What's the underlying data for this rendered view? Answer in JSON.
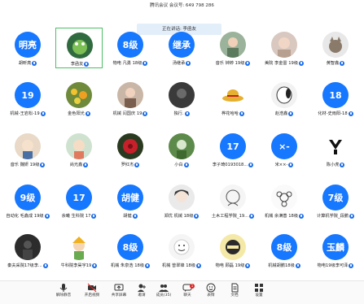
{
  "header": {
    "title": "腾讯会议 会议号: 649 798 286"
  },
  "speaking": {
    "text": "正在讲话: 李函友"
  },
  "participants": [
    {
      "name": "胡昕亮",
      "avatar": "明亮",
      "kind": "text",
      "extra": ""
    },
    {
      "name": "李函友",
      "avatar": "frog-avatar",
      "kind": "pic",
      "extra": ""
    },
    {
      "name": "物电 凡勇 18级",
      "avatar": "8级",
      "kind": "text",
      "extra": ""
    },
    {
      "name": "汤继承",
      "avatar": "继承",
      "kind": "text",
      "extra": ""
    },
    {
      "name": "音乐 钟婷 19级",
      "avatar": "girl-photo-avatar",
      "kind": "pic",
      "extra": ""
    },
    {
      "name": "美院 李金雷 19级",
      "avatar": "portrait-avatar",
      "kind": "pic",
      "extra": ""
    },
    {
      "name": "黄智鑫",
      "avatar": "cat-avatar",
      "kind": "pic",
      "extra": ""
    },
    {
      "name": "机械-王岩松-19",
      "avatar": "19",
      "kind": "text",
      "extra": ""
    },
    {
      "name": "金色阳光",
      "avatar": "flowers-avatar",
      "kind": "pic",
      "extra": ""
    },
    {
      "name": "机械 闫国庆 19",
      "avatar": "person-avatar",
      "kind": "pic",
      "extra": ""
    },
    {
      "name": "独行.",
      "avatar": "dark-avatar",
      "kind": "pic",
      "extra": ""
    },
    {
      "name": "桦花哈哈",
      "avatar": "straw-hat-avatar",
      "kind": "pic",
      "extra": ""
    },
    {
      "name": "赵浩鑫",
      "avatar": "snoopy-avatar",
      "kind": "pic",
      "extra": ""
    },
    {
      "name": "化材-史雨阳-18",
      "avatar": "18",
      "kind": "text",
      "extra": ""
    },
    {
      "name": "音乐 魏妍 19级",
      "avatar": "cartoon-avatar",
      "kind": "pic",
      "extra": ""
    },
    {
      "name": "尚光鑫",
      "avatar": "baby-avatar",
      "kind": "pic",
      "extra": ""
    },
    {
      "name": "罗红杰",
      "avatar": "red-flower-avatar",
      "kind": "pic",
      "extra": ""
    },
    {
      "name": "小白",
      "avatar": "green-avatar",
      "kind": "pic",
      "extra": ""
    },
    {
      "name": "李子琦0193018...",
      "avatar": "17",
      "kind": "text",
      "extra": ""
    },
    {
      "name": "米××-",
      "avatar": "×-",
      "kind": "text",
      "extra": ""
    },
    {
      "name": "陈小虎",
      "avatar": "kobe-logo-avatar",
      "kind": "pic",
      "extra": ""
    },
    {
      "name": "自动化 毛鑫成 19级",
      "avatar": "9级",
      "kind": "text",
      "extra": ""
    },
    {
      "name": "余曦 生科院 17",
      "avatar": "17",
      "kind": "text",
      "extra": ""
    },
    {
      "name": "胡健",
      "avatar": "胡健",
      "kind": "text",
      "extra": ""
    },
    {
      "name": "郑优 机械 18级",
      "avatar": "anime-avatar",
      "kind": "pic",
      "extra": ""
    },
    {
      "name": "土木工程学院_19...",
      "avatar": "sketch-avatar",
      "kind": "pic",
      "extra": ""
    },
    {
      "name": "机械 余满善 18级",
      "avatar": "flower-sketch-avatar",
      "kind": "pic",
      "extra": ""
    },
    {
      "name": "计算机学院_段鹏",
      "avatar": "7级",
      "kind": "text",
      "extra": ""
    },
    {
      "name": "秦夫采院17级李...",
      "avatar": "dark-figure-avatar",
      "kind": "pic",
      "extra": ""
    },
    {
      "name": "牛科院李昊宇19",
      "avatar": "boy-cartoon-avatar",
      "kind": "pic",
      "extra": ""
    },
    {
      "name": "机械 朱泉浩 18级",
      "avatar": "8级",
      "kind": "text",
      "extra": ""
    },
    {
      "name": "机械 曾翠锋 18级",
      "avatar": "white-face-avatar",
      "kind": "pic",
      "extra": ""
    },
    {
      "name": "物电 顾磊 19级",
      "avatar": "ninja-avatar",
      "kind": "pic",
      "extra": ""
    },
    {
      "name": "机械胡鹏18级",
      "avatar": "8级",
      "kind": "text",
      "extra": ""
    },
    {
      "name": "物电19级李可泽",
      "avatar": "玉麟",
      "kind": "text",
      "extra": ""
    }
  ],
  "toolbar": [
    {
      "label": "解除静音",
      "icon": "mic-icon"
    },
    {
      "label": "开启视频",
      "icon": "camera-icon"
    },
    {
      "label": "共享屏幕",
      "icon": "share-screen-icon"
    },
    {
      "label": "邀请",
      "icon": "invite-icon"
    },
    {
      "label": "成员(35)",
      "icon": "members-icon"
    },
    {
      "label": "聊天",
      "icon": "chat-icon",
      "badge": "1"
    },
    {
      "label": "表情",
      "icon": "emoji-icon"
    },
    {
      "label": "文档",
      "icon": "document-icon"
    },
    {
      "label": "设置",
      "icon": "settings-icon"
    }
  ],
  "colors": {
    "accent": "#1677ff",
    "selected_border": "#4cbf64"
  }
}
